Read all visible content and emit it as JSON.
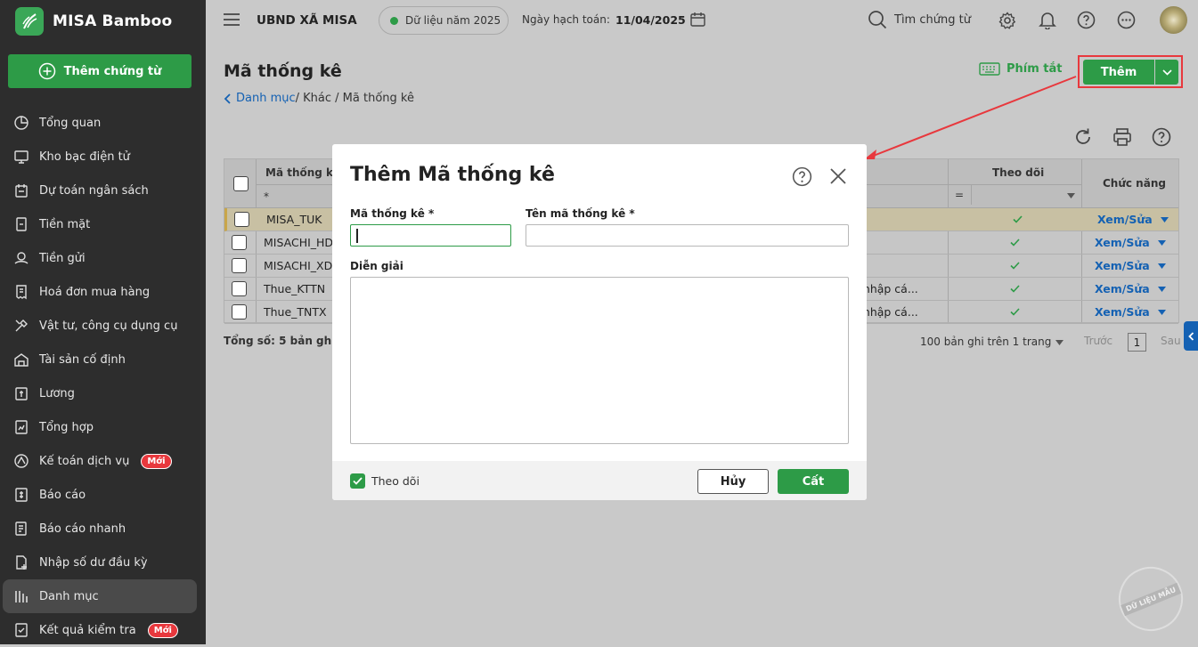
{
  "app": {
    "name": "MISA Bamboo"
  },
  "sidebar": {
    "add_button_label": "Thêm chứng từ",
    "items": [
      {
        "label": "Tổng quan",
        "icon": "pie-chart-icon"
      },
      {
        "label": "Kho bạc điện tử",
        "icon": "monitor-icon"
      },
      {
        "label": "Dự toán ngân sách",
        "icon": "budget-icon"
      },
      {
        "label": "Tiền mặt",
        "icon": "cash-icon"
      },
      {
        "label": "Tiền gửi",
        "icon": "deposit-icon"
      },
      {
        "label": "Hoá đơn mua hàng",
        "icon": "invoice-icon"
      },
      {
        "label": "Vật tư, công cụ dụng cụ",
        "icon": "tools-icon"
      },
      {
        "label": "Tài sản cố định",
        "icon": "building-icon"
      },
      {
        "label": "Lương",
        "icon": "salary-icon"
      },
      {
        "label": "Tổng hợp",
        "icon": "summary-icon"
      },
      {
        "label": "Kế toán dịch vụ",
        "icon": "service-icon",
        "badge": "Mới"
      },
      {
        "label": "Báo cáo",
        "icon": "report-icon"
      },
      {
        "label": "Báo cáo nhanh",
        "icon": "quick-report-icon"
      },
      {
        "label": "Nhập số dư đầu kỳ",
        "icon": "opening-balance-icon"
      },
      {
        "label": "Danh mục",
        "icon": "catalog-icon",
        "active": true
      },
      {
        "label": "Kết quả kiểm tra",
        "icon": "check-result-icon",
        "badge": "Mới"
      }
    ]
  },
  "topbar": {
    "org_name": "UBND XÃ MISA",
    "data_year": "Dữ liệu năm 2025",
    "posting_date_label": "Ngày hạch toán:",
    "posting_date": "11/04/2025",
    "search_label": "Tìm chứng từ"
  },
  "page": {
    "title": "Mã thống kê",
    "breadcrumb_root": "Danh mục",
    "breadcrumb_rest": " / Khác / Mã thống kê",
    "shortcut_label": "Phím tắt",
    "add_label": "Thêm",
    "total_label": "Tổng số: 5 bản ghi",
    "paging_info": "100 bản ghi trên 1 trang",
    "prev_label": "Trước",
    "page_number": "1",
    "next_label": "Sau",
    "watermark": "DỮ LIỆU MẪU"
  },
  "grid": {
    "columns": {
      "code": "Mã thống kê",
      "follow": "Theo dõi",
      "action": "Chức năng"
    },
    "filter_star": "*",
    "filter_eq": "=",
    "rows": [
      {
        "code": "MISA_TUK",
        "desc": "",
        "action": "Xem/Sửa"
      },
      {
        "code": "MISACHI_HD",
        "desc": "",
        "action": "Xem/Sửa"
      },
      {
        "code": "MISACHI_XD",
        "desc": "",
        "action": "Xem/Sửa"
      },
      {
        "code": "Thue_KTTN",
        "desc": "u nhập cá...",
        "action": "Xem/Sửa"
      },
      {
        "code": "Thue_TNTX",
        "desc": "u nhập cá...",
        "action": "Xem/Sửa"
      }
    ]
  },
  "dialog": {
    "title": "Thêm Mã thống kê",
    "code_label": "Mã thống kê *",
    "name_label": "Tên mã thống kê *",
    "desc_label": "Diễn giải",
    "follow_label": "Theo dõi",
    "cancel_label": "Hủy",
    "save_label": "Cất"
  },
  "colors": {
    "brand_green": "#2d9b47",
    "link_blue": "#1461b3",
    "highlight_red": "#e8383d"
  }
}
